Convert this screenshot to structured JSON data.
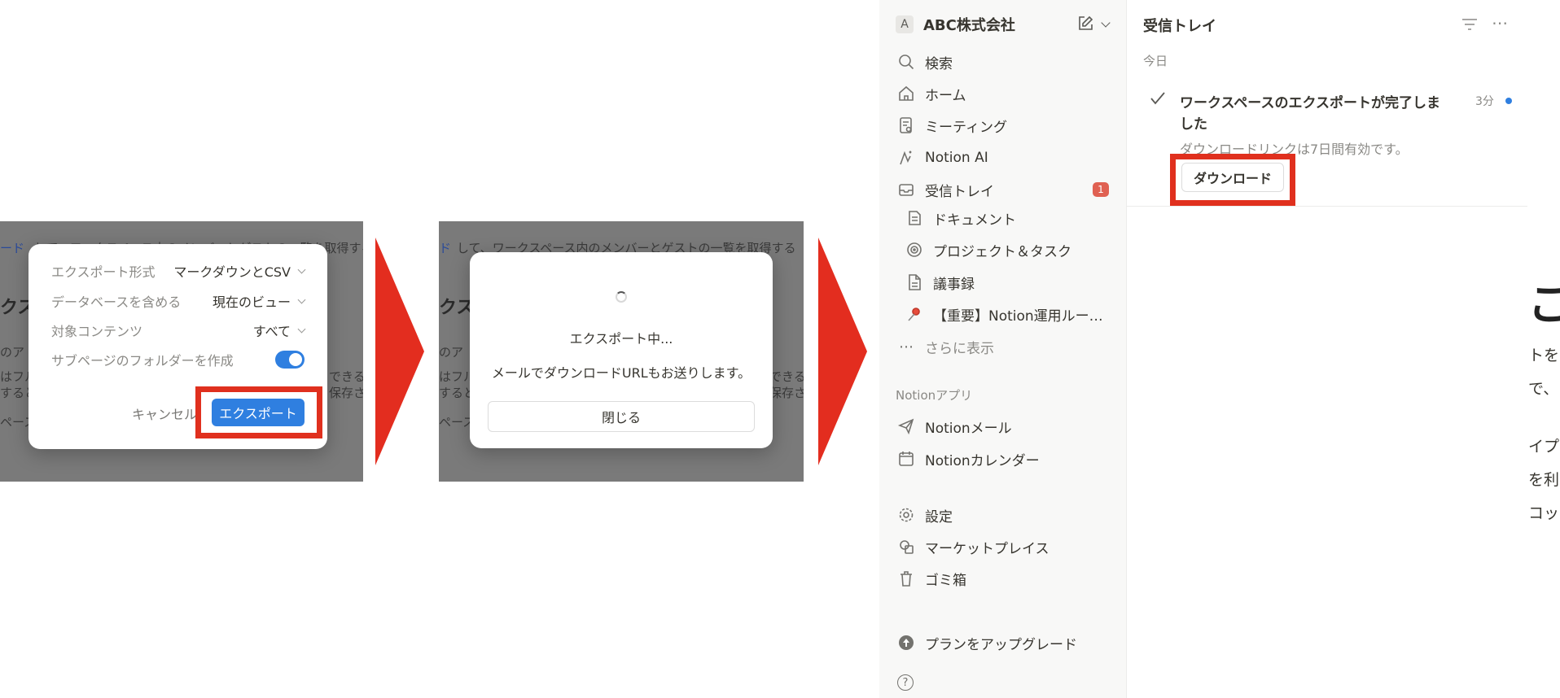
{
  "panel1": {
    "bg": {
      "line1_blue": "ード",
      "line1": "して、ワークスペース内のメンバーとゲストの一覧を取得する",
      "heading": "クス",
      "para1": "のア",
      "para2": "はフル",
      "para3": "すると",
      "para4": "ペース",
      "right1": "できる",
      "right2": "保存さ"
    },
    "dialog": {
      "rows": [
        {
          "label": "エクスポート形式",
          "value": "マークダウンとCSV"
        },
        {
          "label": "データベースを含める",
          "value": "現在のビュー"
        },
        {
          "label": "対象コンテンツ",
          "value": "すべて"
        },
        {
          "label": "サブページのフォルダーを作成",
          "value": ""
        }
      ],
      "toggle_on": true,
      "cancel": "キャンセル",
      "export": "エクスポート"
    }
  },
  "panel2": {
    "bg": {
      "line1_blue": "ド",
      "line1": "して、ワークスペース内のメンバーとゲストの一覧を取得する",
      "heading": "クス",
      "para1": "のア",
      "para2": "はフル",
      "para3": "すると",
      "para4": "ペース",
      "right1": "できる",
      "right2": "保存さ"
    },
    "dialog": {
      "title": "エクスポート中...",
      "message": "メールでダウンロードURLもお送りします。",
      "close": "閉じる"
    }
  },
  "sidebar": {
    "workspace_initial": "A",
    "workspace_name": "ABC株式会社",
    "items": [
      {
        "icon": "search-icon",
        "label": "検索"
      },
      {
        "icon": "home-icon",
        "label": "ホーム"
      },
      {
        "icon": "meeting-icon",
        "label": "ミーティング"
      },
      {
        "icon": "notion-ai-icon",
        "label": "Notion AI"
      },
      {
        "icon": "inbox-icon",
        "label": "受信トレイ",
        "badge": "1"
      }
    ],
    "pages": [
      {
        "icon": "document-icon",
        "label": "ドキュメント"
      },
      {
        "icon": "target-icon",
        "label": "プロジェクト＆タスク"
      },
      {
        "icon": "page-icon",
        "label": "議事録"
      },
      {
        "icon": "pin-icon",
        "label": "【重要】Notion運用ルー…"
      },
      {
        "icon": "more-icon",
        "label": "さらに表示"
      }
    ],
    "apps_section": "Notionアプリ",
    "apps": [
      {
        "icon": "mail-icon",
        "label": "Notionメール"
      },
      {
        "icon": "calendar-icon",
        "label": "Notionカレンダー"
      }
    ],
    "bottom": [
      {
        "icon": "settings-icon",
        "label": "設定"
      },
      {
        "icon": "marketplace-icon",
        "label": "マーケットプレイス"
      },
      {
        "icon": "trash-icon",
        "label": "ゴミ箱"
      }
    ],
    "upgrade": "プランをアップグレード",
    "help": "?"
  },
  "inbox": {
    "title": "受信トレイ",
    "section": "今日",
    "notification": {
      "title_line1": "ワークスペースのエクスポートが完了しま",
      "title_line2": "した",
      "time": "3分",
      "body": "ダウンロードリンクは7日間有効です。",
      "button": "ダウンロード"
    }
  },
  "rightdoc": {
    "heading": "こ",
    "line1": "トを",
    "line2": "で、",
    "line3": "イプ",
    "line4": "を利",
    "line5": "コック"
  },
  "colors": {
    "accent_blue": "#2f7fe0",
    "highlight_red": "#e0301e",
    "arrow_red": "#e32d1f",
    "badge_red": "#e06152",
    "unread_dot": "#2f7fe0"
  }
}
